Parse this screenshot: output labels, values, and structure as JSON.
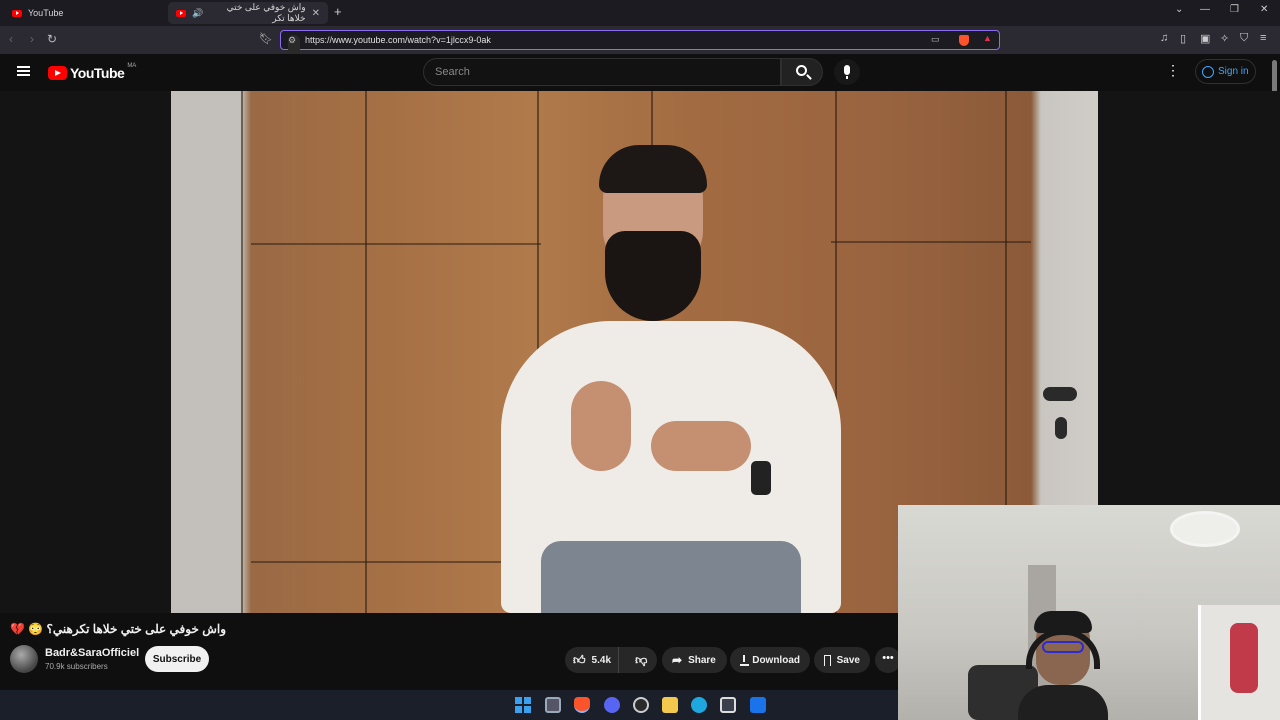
{
  "browser": {
    "tabs": [
      {
        "title": "YouTube",
        "active": false
      },
      {
        "title": "واش خوفي على ختي خلاها تكر",
        "active": true
      }
    ],
    "url": "https://www.youtube.com/watch?v=1jlccx9-0ak"
  },
  "youtube": {
    "logo_text": "YouTube",
    "country_code": "MA",
    "search_placeholder": "Search",
    "sign_in": "Sign in"
  },
  "video": {
    "title": "واش خوفي على ختي خلاها تكرهني؟ 😳 💔",
    "channel": "Badr&SaraOfficiel",
    "subscribers": "70.9k subscribers",
    "subscribe_label": "Subscribe",
    "likes": "5.4k",
    "share_label": "Share",
    "download_label": "Download",
    "save_label": "Save"
  },
  "colors": {
    "accent_blue": "#3ea6ff",
    "youtube_red": "#ff0000",
    "background": "#0f0f0f"
  }
}
